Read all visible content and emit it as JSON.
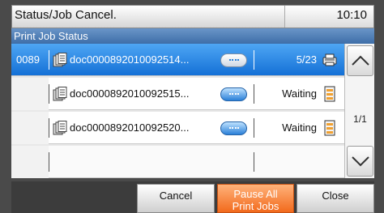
{
  "header": {
    "title": "Status/Job Cancel.",
    "time": "10:10"
  },
  "subheader": {
    "label": "Print Job Status"
  },
  "rows": [
    {
      "id": "0089",
      "doc": "doc0000892010092514...",
      "status": "5/23",
      "selected": true
    },
    {
      "id": "",
      "doc": "doc0000892010092515...",
      "status": "Waiting",
      "selected": false
    },
    {
      "id": "",
      "doc": "doc0000892010092520...",
      "status": "Waiting",
      "selected": false
    }
  ],
  "pager": {
    "page": "1/1"
  },
  "buttons": {
    "cancel": "Cancel",
    "pause_all_line1": "Pause All",
    "pause_all_line2": "Print Jobs",
    "close": "Close"
  },
  "icons": {
    "doc": "document-stack-icon",
    "printing": "printer-icon",
    "waiting": "waiting-queue-icon",
    "details": "details-button-icon",
    "up": "chevron-up-icon",
    "down": "chevron-down-icon"
  },
  "colors": {
    "selected_row": "#1f7fe0",
    "accent_button": "#f26a1c",
    "subheader": "#4f7fb8"
  }
}
